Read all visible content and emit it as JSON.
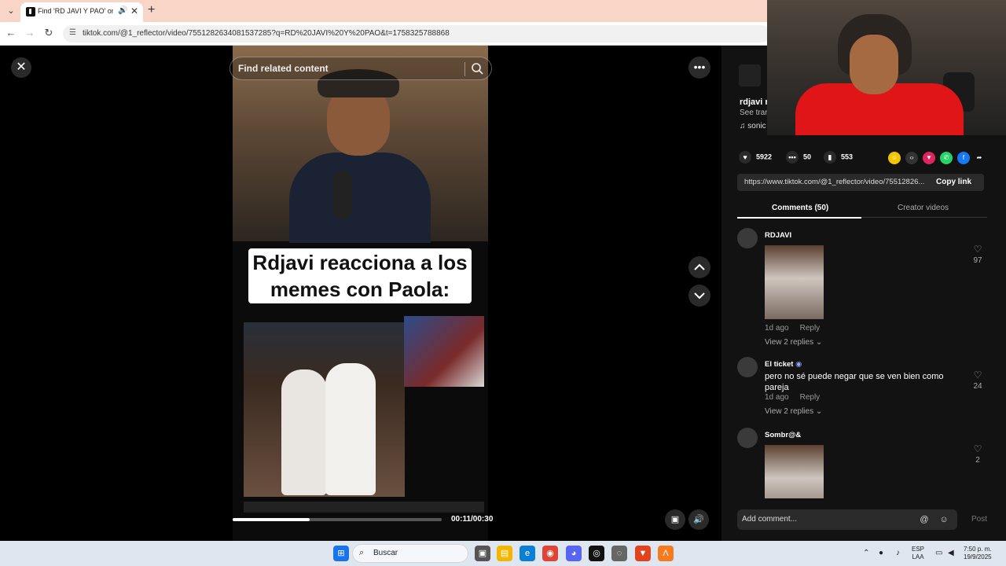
{
  "browser": {
    "tab_title": "Find 'RD JAVI Y PAO' on TikT",
    "url": "tiktok.com/@1_reflector/video/7551282634081537285?q=RD%20JAVI%20Y%20PAO&t=1758325788868"
  },
  "video": {
    "search_placeholder": "Find related content",
    "caption_line1": "Rdjavi reacciona a los",
    "caption_line2": "memes con Paola:",
    "time": "00:11/00:30",
    "progress": 0.3667
  },
  "panel": {
    "creator_name": "rdjavi re",
    "creator_sub": "See trar",
    "music": "sonic",
    "stats": {
      "likes": "5922",
      "comments": "50",
      "saves": "553"
    },
    "share_link": "https://www.tiktok.com/@1_reflector/video/75512826...",
    "copy_link_label": "Copy link",
    "tabs": [
      "Comments (50)",
      "Creator videos"
    ],
    "comments": [
      {
        "user": "RDJAVI",
        "text": "",
        "time": "1d ago",
        "reply": "Reply",
        "replies": "View 2 replies",
        "likes": "97"
      },
      {
        "user": "El ticket",
        "text": "pero no sé puede negar que se ven bien como pareja",
        "time": "1d ago",
        "reply": "Reply",
        "replies": "View 2 replies",
        "likes": "24"
      },
      {
        "user": "Sombr@&",
        "text": "",
        "time": "",
        "reply": "",
        "replies": "",
        "likes": "2"
      }
    ],
    "add_comment_placeholder": "Add comment...",
    "post_label": "Post"
  },
  "taskbar": {
    "search_placeholder": "Buscar",
    "lang_top": "ESP",
    "lang_bottom": "LAA",
    "time": "7:50 p. m.",
    "date": "19/9/2025"
  },
  "colors": {
    "tab_bar": "#f8d5c6",
    "panel_bg": "#121212",
    "webcam_shirt": "#e01518",
    "like_stat_gold": "#f5c400"
  },
  "icons": [
    "tiktok-icon",
    "audio-icon",
    "search-icon",
    "more-icon",
    "chevron-up-icon",
    "chevron-down-icon",
    "heart-icon",
    "comment-icon",
    "bookmark-icon",
    "share-icon",
    "at-icon",
    "emoji-icon",
    "windows-icon"
  ]
}
